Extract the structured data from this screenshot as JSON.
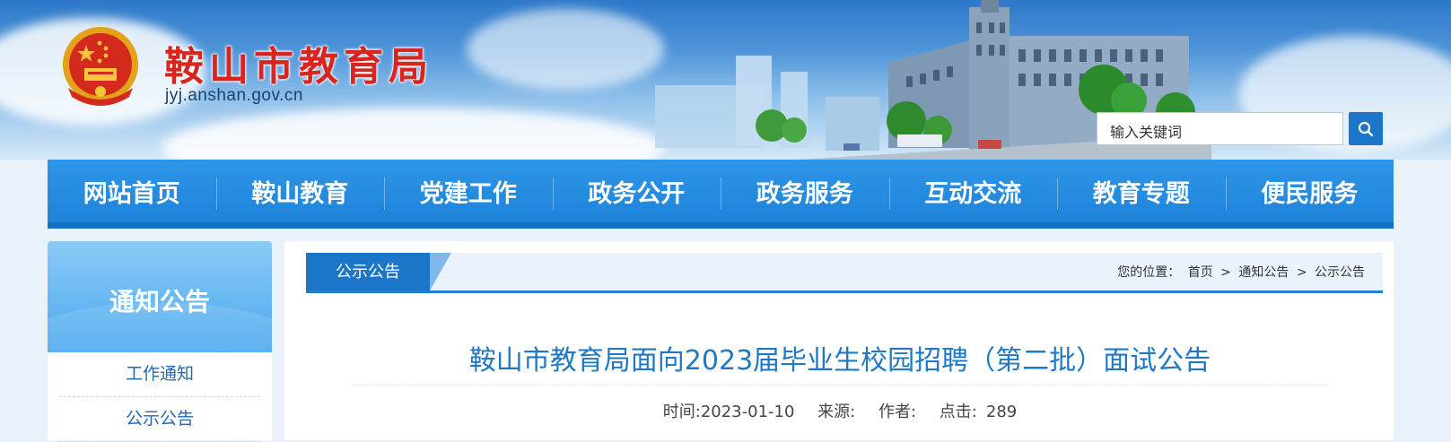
{
  "site": {
    "title": "鞍山市教育局",
    "domain": "jyj.anshan.gov.cn",
    "emblem_icon": "national-emblem-icon"
  },
  "search": {
    "placeholder": "输入关键词",
    "button_icon": "search-icon"
  },
  "nav": {
    "items": [
      "网站首页",
      "鞍山教育",
      "党建工作",
      "政务公开",
      "政务服务",
      "互动交流",
      "教育专题",
      "便民服务"
    ]
  },
  "sidebar": {
    "title": "通知公告",
    "items": [
      "工作通知",
      "公示公告"
    ]
  },
  "section": {
    "tab_label": "公示公告",
    "breadcrumb_prefix": "您的位置：",
    "breadcrumb": [
      "首页",
      "通知公告",
      "公示公告"
    ],
    "separator": ">"
  },
  "article": {
    "title": "鞍山市教育局面向2023届毕业生校园招聘（第二批）面试公告",
    "time_label": "时间:2023-01-10",
    "source_label": "来源:",
    "author_label": "作者:",
    "clicks_label": "点击:",
    "clicks_value": "289"
  },
  "colors": {
    "nav_blue": "#1d84da",
    "title_red": "#d8251f",
    "article_title_blue": "#1f78c6"
  }
}
